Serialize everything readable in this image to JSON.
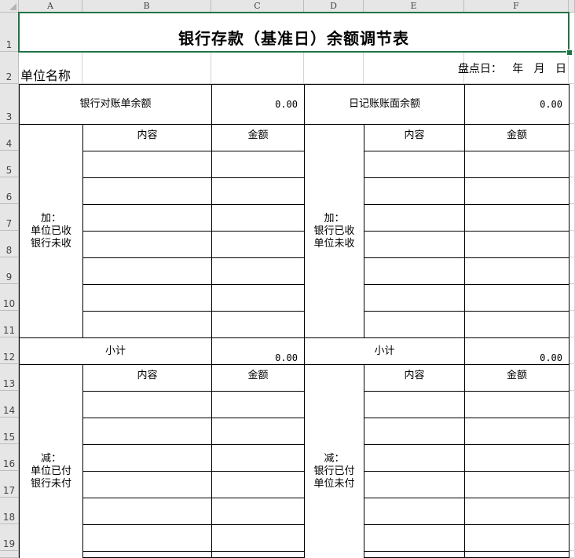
{
  "column_headers": [
    "A",
    "B",
    "C",
    "D",
    "E",
    "F"
  ],
  "row_headers": [
    "1",
    "2",
    "3",
    "4",
    "5",
    "6",
    "7",
    "8",
    "9",
    "10",
    "11",
    "12",
    "13",
    "14",
    "15",
    "16",
    "17",
    "18",
    "19"
  ],
  "sheet": {
    "title": "银行存款（基准日）余额调节表",
    "unit_name_label": "单位名称",
    "count_date_label": "盘点日：   年   月   日",
    "bank_statement_balance_label": "银行对账单余额",
    "bank_statement_balance_value": "0.00",
    "journal_balance_label": "日记账账面余额",
    "journal_balance_value": "0.00",
    "add_section": {
      "left_label": "加：\n单位已收\n银行未收",
      "right_label": "加：\n银行已收\n单位未收",
      "content_header": "内容",
      "amount_header": "金额",
      "left_subtotal_label": "小计",
      "left_subtotal_value": "0.00",
      "right_subtotal_label": "小计",
      "right_subtotal_value": "0.00"
    },
    "subtract_section": {
      "left_label": "减：\n单位已付\n银行未付",
      "right_label": "减：\n银行已付\n单位未付",
      "content_header": "内容",
      "amount_header": "金额"
    }
  },
  "colors": {
    "selection": "#217346",
    "gridline": "#d4d4d4",
    "header_bg": "#e6e6e6"
  }
}
